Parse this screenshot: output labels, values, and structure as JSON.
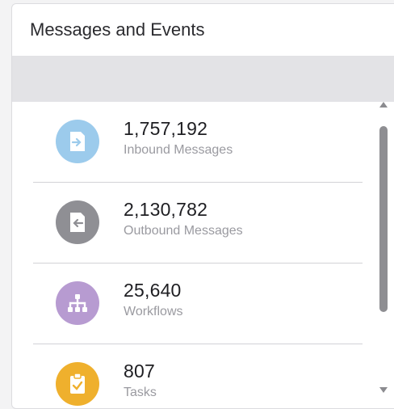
{
  "panel": {
    "title": "Messages and Events"
  },
  "stats": [
    {
      "value": "1,757,192",
      "label": "Inbound Messages",
      "icon": "inbound-message-icon",
      "color": "#9ccbec"
    },
    {
      "value": "2,130,782",
      "label": "Outbound Messages",
      "icon": "outbound-message-icon",
      "color": "#8f8f94"
    },
    {
      "value": "25,640",
      "label": "Workflows",
      "icon": "workflow-icon",
      "color": "#b79bd1"
    },
    {
      "value": "807",
      "label": "Tasks",
      "icon": "clipboard-check-icon",
      "color": "#efb02d"
    }
  ]
}
